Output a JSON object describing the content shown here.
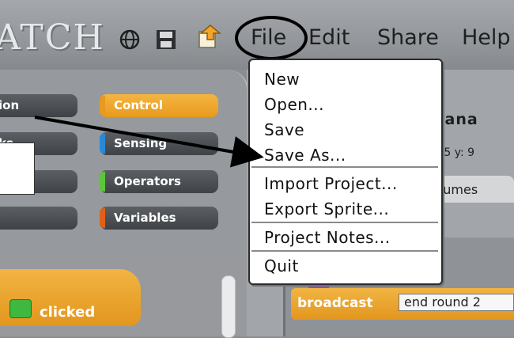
{
  "app": {
    "logo_text": "ATCH"
  },
  "toolbar": {
    "icons": [
      "globe-icon",
      "save-disk-icon",
      "share-upload-icon"
    ],
    "menus": {
      "file": "File",
      "edit": "Edit",
      "share": "Share",
      "help": "Help"
    }
  },
  "categories": {
    "left_col": [
      "ion",
      "ks",
      "d"
    ],
    "right_col": [
      {
        "label": "Control",
        "color": "#e89a1d",
        "selected": true
      },
      {
        "label": "Sensing",
        "color": "#2a89d6",
        "selected": false
      },
      {
        "label": "Operators",
        "color": "#5cc63a",
        "selected": false
      },
      {
        "label": "Variables",
        "color": "#e0601a",
        "selected": false
      }
    ]
  },
  "sprite": {
    "name_partial": "nana",
    "coords_partial": ".65  y: 9"
  },
  "tabs": {
    "costumes_partial": "tumes"
  },
  "scripts": {
    "hat_label": "clicked",
    "broadcast_label": "broadcast",
    "broadcast_value": "end round 2"
  },
  "file_menu": {
    "items": [
      "New",
      "Open...",
      "Save",
      "Save As...",
      "Import Project...",
      "Export Sprite...",
      "Project Notes...",
      "Quit"
    ]
  }
}
